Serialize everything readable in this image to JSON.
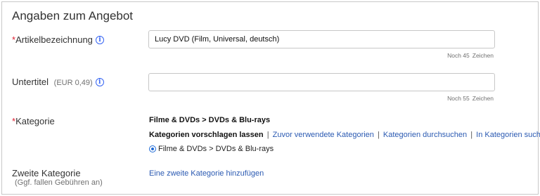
{
  "section": {
    "title": "Angaben zum Angebot"
  },
  "title_field": {
    "required_mark": "*",
    "label": "Artikelbezeichnung",
    "info": "i",
    "value": "Lucy DVD (Film, Universal, deutsch)",
    "counter_value": "Noch 45",
    "counter_word": "Zeichen"
  },
  "subtitle_field": {
    "label": "Untertitel",
    "price": "(EUR 0,49)",
    "info": "i",
    "value": "",
    "counter_value": "Noch 55",
    "counter_word": "Zeichen"
  },
  "category": {
    "required_mark": "*",
    "label": "Kategorie",
    "path": "Filme & DVDs > DVDs & Blu-rays",
    "suggest_label": "Kategorien vorschlagen lassen",
    "separator": "|",
    "links": [
      "Zuvor verwendete Kategorien",
      "Kategorien durchsuchen",
      "In Kategorien suchen"
    ],
    "selected_option": "Filme & DVDs > DVDs & Blu-rays"
  },
  "second_category": {
    "label": "Zweite Kategorie",
    "note": "(Ggf. fallen Gebühren an)",
    "add_link": "Eine zweite Kategorie hinzufügen"
  },
  "colors": {
    "link": "#2b5ab2",
    "required": "#dd1e31",
    "info": "#3665f3",
    "border": "#c7c7c7"
  }
}
